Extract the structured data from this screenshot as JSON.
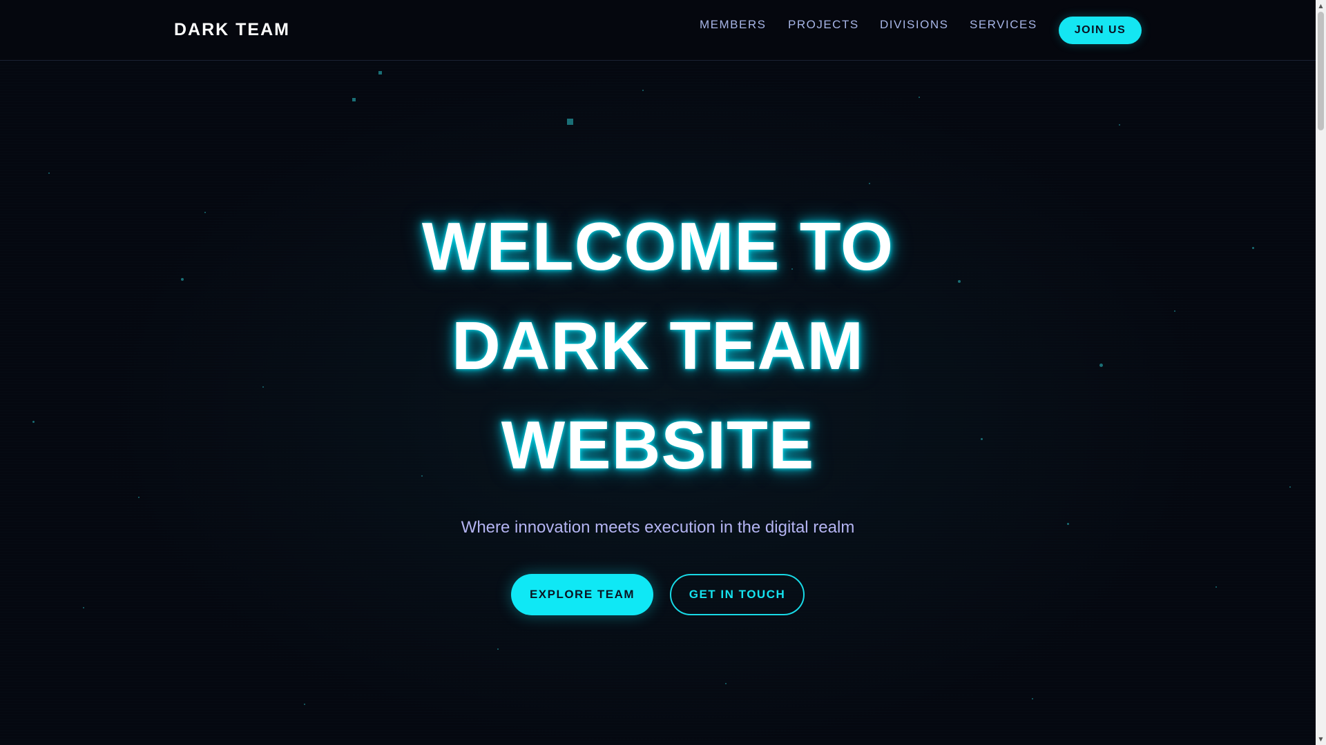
{
  "navbar": {
    "brand": "DARK TEAM",
    "links": [
      {
        "label": "MEMBERS"
      },
      {
        "label": "PROJECTS"
      },
      {
        "label": "DIVISIONS"
      },
      {
        "label": "SERVICES"
      }
    ],
    "cta_label": "JOIN US"
  },
  "hero": {
    "title_lines": [
      "WELCOME TO",
      "DARK TEAM",
      "WEBSITE"
    ],
    "subtitle": "Where innovation meets execution in the digital realm",
    "primary_button": "EXPLORE TEAM",
    "secondary_button": "GET IN TOUCH"
  },
  "colors": {
    "accent": "#0fe8f5",
    "background": "#050810",
    "nav_link": "#a7b5e6",
    "subtitle": "#b4b4f2"
  },
  "icons": {
    "scroll_up": "scroll-up-arrow-icon",
    "scroll_down": "scroll-down-arrow-icon"
  }
}
